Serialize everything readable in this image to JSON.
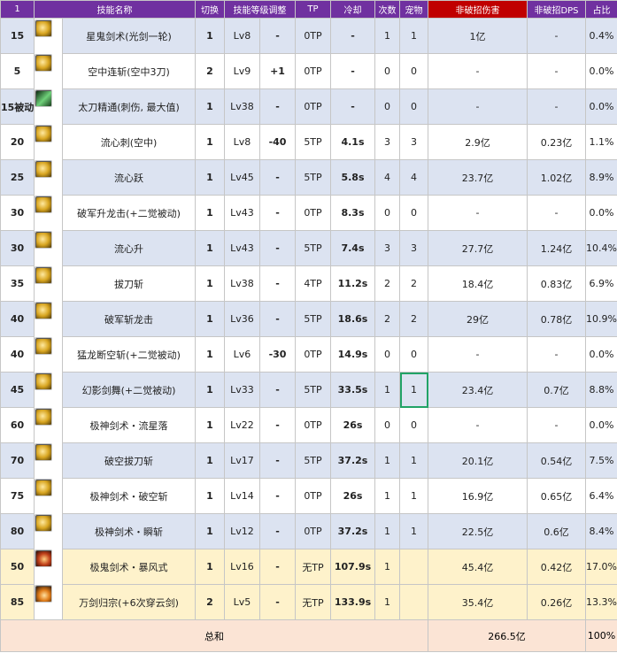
{
  "headers": [
    "1",
    "技能名称",
    "切换",
    "技能等级调整",
    "TP",
    "冷却",
    "次数",
    "宠物",
    "非破招伤害",
    "非破招DPS",
    "占比"
  ],
  "rows": [
    {
      "level": "15",
      "icon": "sword-burst-icon",
      "icon_style": "gold",
      "name": "星鬼剑术(光剑一轮)",
      "switch": "1",
      "skill_level": "Lv8",
      "adjust": "-",
      "tp": "0TP",
      "cooldown": "-",
      "count": "1",
      "pet": "1",
      "damage": "1亿",
      "dps": "-",
      "ratio": "0.4%",
      "row_style": "blue"
    },
    {
      "level": "5",
      "icon": "air-slash-icon",
      "icon_style": "gold",
      "name": "空中连斩(空中3刀)",
      "switch": "2",
      "skill_level": "Lv9",
      "adjust": "+1",
      "tp": "0TP",
      "cooldown": "-",
      "count": "0",
      "pet": "0",
      "damage": "-",
      "dps": "-",
      "ratio": "0.0%",
      "row_style": "white"
    },
    {
      "level": "15被动",
      "icon": "katana-mastery-icon",
      "icon_style": "green",
      "name": "太刀精通(刺伤, 最大值)",
      "switch": "1",
      "skill_level": "Lv38",
      "adjust": "-",
      "tp": "0TP",
      "cooldown": "-",
      "count": "0",
      "pet": "0",
      "damage": "-",
      "dps": "-",
      "ratio": "0.0%",
      "row_style": "blue"
    },
    {
      "level": "20",
      "icon": "flowing-thrust-icon",
      "icon_style": "gold",
      "name": "流心刺(空中)",
      "switch": "1",
      "skill_level": "Lv8",
      "adjust": "-40",
      "tp": "5TP",
      "cooldown": "4.1s",
      "count": "3",
      "pet": "3",
      "damage": "2.9亿",
      "dps": "0.23亿",
      "ratio": "1.1%",
      "row_style": "white"
    },
    {
      "level": "25",
      "icon": "flowing-leap-icon",
      "icon_style": "gold",
      "name": "流心跃",
      "switch": "1",
      "skill_level": "Lv45",
      "adjust": "-",
      "tp": "5TP",
      "cooldown": "5.8s",
      "count": "4",
      "pet": "4",
      "damage": "23.7亿",
      "dps": "1.02亿",
      "ratio": "8.9%",
      "row_style": "blue"
    },
    {
      "level": "30",
      "icon": "dragon-rise-icon",
      "icon_style": "gold",
      "name": "破军升龙击(+二觉被动)",
      "switch": "1",
      "skill_level": "Lv43",
      "adjust": "-",
      "tp": "0TP",
      "cooldown": "8.3s",
      "count": "0",
      "pet": "0",
      "damage": "-",
      "dps": "-",
      "ratio": "0.0%",
      "row_style": "white"
    },
    {
      "level": "30",
      "icon": "flowing-rise-icon",
      "icon_style": "gold",
      "name": "流心升",
      "switch": "1",
      "skill_level": "Lv43",
      "adjust": "-",
      "tp": "5TP",
      "cooldown": "7.4s",
      "count": "3",
      "pet": "3",
      "damage": "27.7亿",
      "dps": "1.24亿",
      "ratio": "10.4%",
      "row_style": "blue"
    },
    {
      "level": "35",
      "icon": "draw-slash-icon",
      "icon_style": "gold",
      "name": "拔刀斩",
      "switch": "1",
      "skill_level": "Lv38",
      "adjust": "-",
      "tp": "4TP",
      "cooldown": "11.2s",
      "count": "2",
      "pet": "2",
      "damage": "18.4亿",
      "dps": "0.83亿",
      "ratio": "6.9%",
      "row_style": "white"
    },
    {
      "level": "40",
      "icon": "dragon-slash-icon",
      "icon_style": "gold",
      "name": "破军斩龙击",
      "switch": "1",
      "skill_level": "Lv36",
      "adjust": "-",
      "tp": "5TP",
      "cooldown": "18.6s",
      "count": "2",
      "pet": "2",
      "damage": "29亿",
      "dps": "0.78亿",
      "ratio": "10.9%",
      "row_style": "blue"
    },
    {
      "level": "40",
      "icon": "dragon-cleave-icon",
      "icon_style": "gold",
      "name": "猛龙断空斩(+二觉被动)",
      "switch": "1",
      "skill_level": "Lv6",
      "adjust": "-30",
      "tp": "0TP",
      "cooldown": "14.9s",
      "count": "0",
      "pet": "0",
      "damage": "-",
      "dps": "-",
      "ratio": "0.0%",
      "row_style": "white"
    },
    {
      "level": "45",
      "icon": "phantom-dance-icon",
      "icon_style": "gold",
      "name": "幻影剑舞(+二觉被动)",
      "switch": "1",
      "skill_level": "Lv33",
      "adjust": "-",
      "tp": "5TP",
      "cooldown": "33.5s",
      "count": "1",
      "pet": "1",
      "damage": "23.4亿",
      "dps": "0.7亿",
      "ratio": "8.8%",
      "row_style": "blue"
    },
    {
      "level": "60",
      "icon": "meteor-fall-icon",
      "icon_style": "gold",
      "name": "极神剑术・流星落",
      "switch": "1",
      "skill_level": "Lv22",
      "adjust": "-",
      "tp": "0TP",
      "cooldown": "26s",
      "count": "0",
      "pet": "0",
      "damage": "-",
      "dps": "-",
      "ratio": "0.0%",
      "row_style": "white"
    },
    {
      "level": "70",
      "icon": "void-draw-icon",
      "icon_style": "gold",
      "name": "破空拔刀斩",
      "switch": "1",
      "skill_level": "Lv17",
      "adjust": "-",
      "tp": "5TP",
      "cooldown": "37.2s",
      "count": "1",
      "pet": "1",
      "damage": "20.1亿",
      "dps": "0.54亿",
      "ratio": "7.5%",
      "row_style": "blue"
    },
    {
      "level": "75",
      "icon": "void-slash-icon",
      "icon_style": "gold",
      "name": "极神剑术・破空斩",
      "switch": "1",
      "skill_level": "Lv14",
      "adjust": "-",
      "tp": "0TP",
      "cooldown": "26s",
      "count": "1",
      "pet": "1",
      "damage": "16.9亿",
      "dps": "0.65亿",
      "ratio": "6.4%",
      "row_style": "white"
    },
    {
      "level": "80",
      "icon": "flash-slash-icon",
      "icon_style": "gold",
      "name": "极神剑术・瞬斩",
      "switch": "1",
      "skill_level": "Lv12",
      "adjust": "-",
      "tp": "0TP",
      "cooldown": "37.2s",
      "count": "1",
      "pet": "1",
      "damage": "22.5亿",
      "dps": "0.6亿",
      "ratio": "8.4%",
      "row_style": "blue"
    },
    {
      "level": "50",
      "icon": "storm-style-icon",
      "icon_style": "red",
      "name": "极鬼剑术・暴风式",
      "switch": "1",
      "skill_level": "Lv16",
      "adjust": "-",
      "tp": "无TP",
      "cooldown": "107.9s",
      "count": "1",
      "pet": "",
      "damage": "45.4亿",
      "dps": "0.42亿",
      "ratio": "17.0%",
      "row_style": "yellow"
    },
    {
      "level": "85",
      "icon": "ten-thousand-swords-icon",
      "icon_style": "orange",
      "name": "万剑归宗(+6次穿云剑)",
      "switch": "2",
      "skill_level": "Lv5",
      "adjust": "-",
      "tp": "无TP",
      "cooldown": "133.9s",
      "count": "1",
      "pet": "",
      "damage": "35.4亿",
      "dps": "0.26亿",
      "ratio": "13.3%",
      "row_style": "yellow"
    }
  ],
  "total": {
    "label": "总和",
    "damage": "266.5亿",
    "ratio": "100%"
  },
  "colors": {
    "header_bg": "#7031a0",
    "header_red": "#c00000",
    "row_blue": "#dce3f1",
    "row_yellow": "#fef2cb",
    "total_bg": "#fbe4d5",
    "dps_red": "#c00000",
    "selection": "#21a366"
  }
}
